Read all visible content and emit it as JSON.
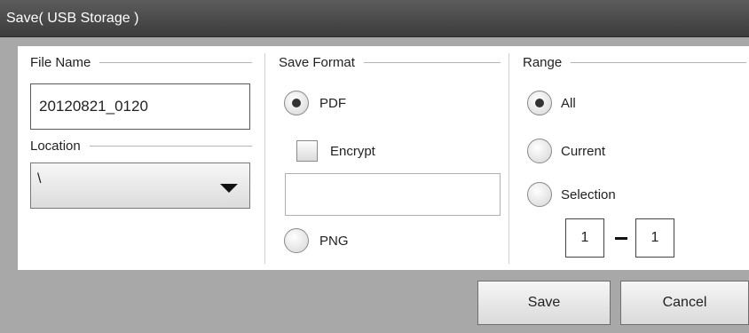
{
  "window": {
    "title": "Save( USB Storage )"
  },
  "file_name": {
    "label": "File Name",
    "value": "20120821_0120"
  },
  "location": {
    "label": "Location",
    "value": "\\"
  },
  "save_format": {
    "label": "Save Format",
    "pdf_label": "PDF",
    "pdf_selected": true,
    "encrypt_label": "Encrypt",
    "encrypt_checked": false,
    "password_value": "",
    "png_label": "PNG",
    "png_selected": false
  },
  "range": {
    "label": "Range",
    "all_label": "All",
    "all_selected": true,
    "current_label": "Current",
    "selection_label": "Selection",
    "from": "1",
    "to": "1"
  },
  "buttons": {
    "save_label": "Save",
    "cancel_label": "Cancel"
  }
}
